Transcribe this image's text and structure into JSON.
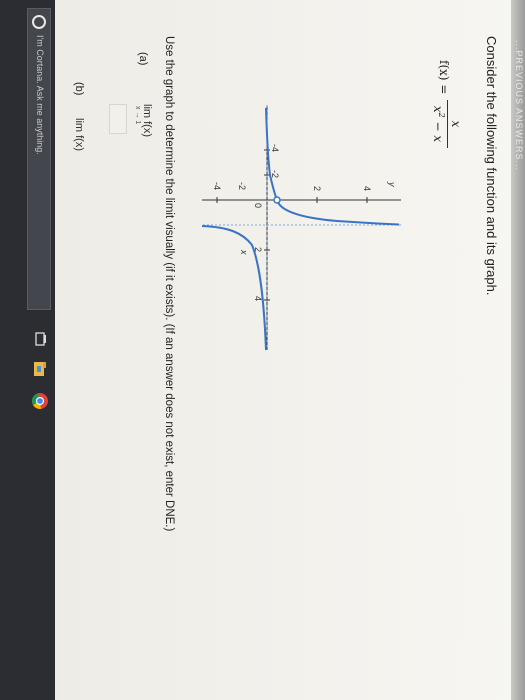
{
  "header": {
    "strip_text": "...PREVIOUS ANSWERS..."
  },
  "problem": {
    "prompt": "Consider the following function and its graph.",
    "function_lhs": "f(x) =",
    "numerator": "x",
    "denominator_base": "x",
    "denominator_exp": "2",
    "denominator_rest": " − x"
  },
  "graph": {
    "x_label": "x",
    "y_label": "y",
    "x_ticks": [
      "-4",
      "-2",
      "0",
      "2",
      "4"
    ],
    "y_ticks": [
      "4",
      "2",
      "-2",
      "-4"
    ]
  },
  "instruction": "Use the graph to determine the limit visually (if it exists). (If an answer does not exist, enter DNE.)",
  "parts": [
    {
      "label": "(a)",
      "lim": "lim  f(x)",
      "approach": "x → 1"
    },
    {
      "label": "(b)",
      "lim": "lim  f(x)",
      "approach": ""
    }
  ],
  "taskbar": {
    "cortana_placeholder": "I'm Cortana. Ask me anything.",
    "icons": [
      "cortana-ring-icon",
      "task-view-icon",
      "file-explorer-icon",
      "chrome-icon"
    ]
  },
  "colors": {
    "curve": "#3b74c4",
    "axes": "#333333",
    "page": "#f4f3ef",
    "taskbar": "#2b2d33"
  }
}
